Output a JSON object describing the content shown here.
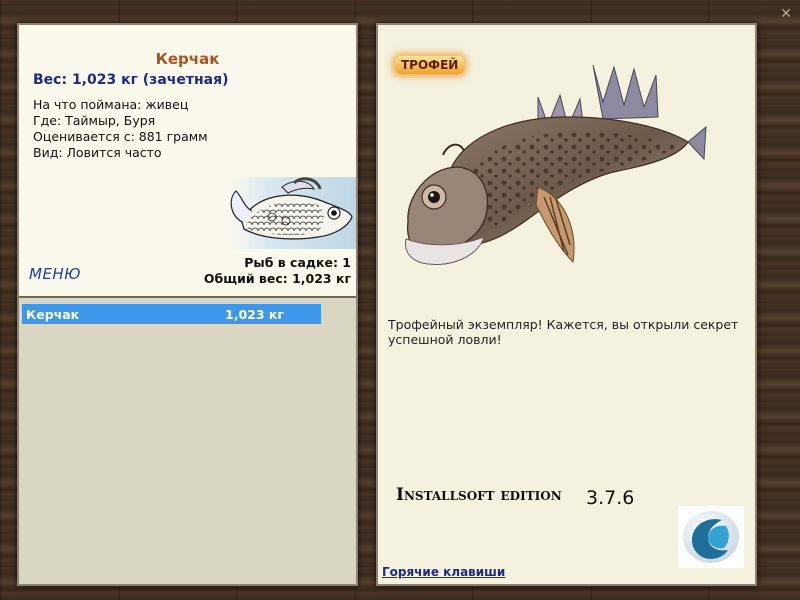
{
  "left": {
    "fish_name": "Керчак",
    "fish_weight": "Вес: 1,023 кг (зачетная)",
    "caught_with": "На что поймана: живец",
    "where": "Где: Таймыр, Буря",
    "rated_from": "Оценивается с: 881 грамм",
    "kind": "Вид: Ловится часто",
    "menu_label": "МЕНЮ",
    "fish_in_cage": "Рыб в садке: 1",
    "total_weight": "Общий вес: 1,023 кг"
  },
  "cage": {
    "rows": [
      {
        "name": "Керчак",
        "weight": "1,023 кг"
      }
    ]
  },
  "right": {
    "trophy_label": "ТРОФЕЙ",
    "trophy_text": "Трофейный экземпляр! Кажется, вы открыли секрет успешной ловли!",
    "edition": "Installsoft edition",
    "version": "3.7.6",
    "hotkeys": "Горячие клавиши"
  },
  "colors": {
    "fish_name": "#b0521d",
    "weight_text": "#1e2a8a",
    "selected_row": "#3e97e8",
    "panel_bg": "#f4f1de"
  },
  "icons": {
    "close": "close-icon",
    "emblem": "fish-emblem-icon",
    "logo": "installsoft-logo-icon"
  }
}
